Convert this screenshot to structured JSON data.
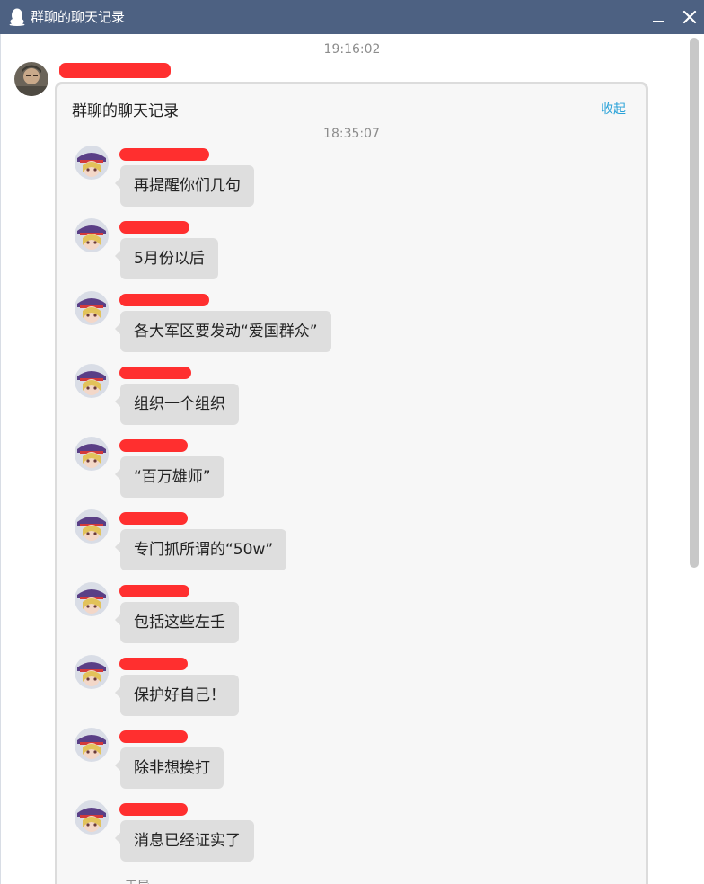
{
  "window": {
    "title": "群聊的聊天记录",
    "minimize_label": "",
    "close_label": ""
  },
  "outer": {
    "timestamp": "19:16:02"
  },
  "card": {
    "title": "群聊的聊天记录",
    "collapse_label": "收起",
    "timestamp": "18:35:07",
    "messages": [
      {
        "text": "再提醒你们几句"
      },
      {
        "text": "5月份以后"
      },
      {
        "text": "各大军区要发动“爱国群众”"
      },
      {
        "text": "组织一个组织"
      },
      {
        "text": "“百万雄师”"
      },
      {
        "text": "专门抓所谓的“50w”"
      },
      {
        "text": "包括这些左壬"
      },
      {
        "text": "保护好自己！"
      },
      {
        "text": "除非想挨打"
      },
      {
        "text": "消息已经证实了"
      }
    ],
    "partial_sender": "王导..."
  },
  "colors": {
    "titlebar": "#4d6182",
    "bubble": "#dedede",
    "link": "#2aa2d8",
    "redaction": "#ff2f2f"
  },
  "icons": {
    "app": "penguin-icon",
    "minimize": "minimize-icon",
    "close": "close-icon"
  }
}
